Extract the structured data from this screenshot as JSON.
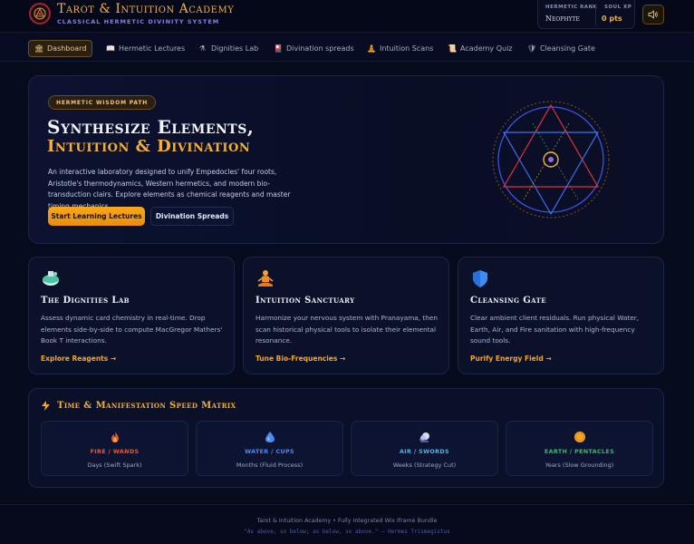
{
  "header": {
    "title": "Tarot & Intuition Academy",
    "subtitle": "CLASSICAL HERMETIC DIVINITY SYSTEM",
    "rank_label": "HERMETIC RANK",
    "rank_value": "Neophyte",
    "xp_label": "SOUL XP",
    "xp_value": "0 pts",
    "logo_icon": "sigil-logo-icon",
    "sound_icon": "speaker-icon"
  },
  "nav": {
    "items": [
      {
        "label": "Dashboard",
        "icon": "temple-icon",
        "active": true
      },
      {
        "label": "Hermetic Lectures",
        "icon": "book-icon"
      },
      {
        "label": "Dignities Lab",
        "icon": "flask-icon"
      },
      {
        "label": "Divination spreads",
        "icon": "card-icon"
      },
      {
        "label": "Intuition Scans",
        "icon": "meditation-icon"
      },
      {
        "label": "Academy Quiz",
        "icon": "scroll-icon"
      },
      {
        "label": "Cleansing Gate",
        "icon": "shield-icon"
      }
    ]
  },
  "hero": {
    "badge": "HERMETIC WISDOM PATH",
    "title_line1": "Synthesize Elements,",
    "title_line2": "Intuition & Divination",
    "description": "An interactive laboratory designed to unify Empedocles' four roots, Aristotle's thermodynamics, Western hermetics, and modern bio-transduction clairs. Explore elements as chemical reagents and master timing mechanics.",
    "primary_button": "Start Learning Lectures",
    "secondary_button": "Divination Spreads",
    "colors": {
      "fire": "#e0303c",
      "water": "#3b6ff0",
      "accent": "#f5b030"
    }
  },
  "cards": [
    {
      "title": "The Dignities Lab",
      "description": "Assess dynamic card chemistry in real-time. Drop elements side-by-side to compute MacGregor Mathers' Book T interactions.",
      "link": "Explore Reagents →",
      "icon": "flask-icon"
    },
    {
      "title": "Intuition Sanctuary",
      "description": "Harmonize your nervous system with Pranayama, then scan historical physical tools to isolate their elemental resonance.",
      "link": "Tune Bio-Frequencies →",
      "icon": "meditation-icon"
    },
    {
      "title": "Cleansing Gate",
      "description": "Clear ambient client residuals. Run physical Water, Earth, Air, and Fire sanitation with high-frequency sound tools.",
      "link": "Purify Energy Field →",
      "icon": "shield-icon"
    }
  ],
  "matrix": {
    "title": "Time & Manifestation Speed Matrix",
    "icon": "lightning-icon",
    "items": [
      {
        "name": "FIRE / WANDS",
        "desc": "Days (Swift Spark)",
        "color": "#f0562e",
        "icon": "fire-icon"
      },
      {
        "name": "WATER / CUPS",
        "desc": "Months (Fluid Process)",
        "color": "#4a8cf5",
        "icon": "water-drop-icon"
      },
      {
        "name": "AIR / SWORDS",
        "desc": "Weeks (Strategy Cut)",
        "color": "#49b8e8",
        "icon": "wind-icon"
      },
      {
        "name": "EARTH / PENTACLES",
        "desc": "Years (Slow Grounding)",
        "color": "#2fbf6a",
        "icon": "coin-icon"
      }
    ]
  },
  "footer": {
    "line1": "Tarot & Intuition Academy • Fully Integrated Wix Iframe Bundle",
    "line2": "\"As above, so below; as below, so above.\" — Hermes Trismegistus"
  }
}
